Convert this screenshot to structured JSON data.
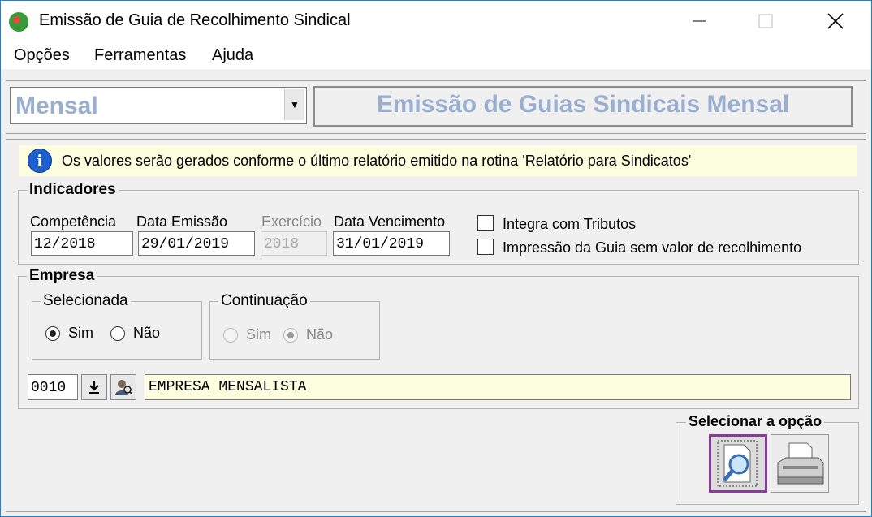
{
  "window": {
    "title": "Emissão de Guia de Recolhimento Sindical"
  },
  "menu": {
    "items": [
      "Opções",
      "Ferramentas",
      "Ajuda"
    ]
  },
  "period_select": {
    "value": "Mensal"
  },
  "header": {
    "title": "Emissão de Guias Sindicais Mensal"
  },
  "info": {
    "text": "Os valores serão gerados conforme o último relatório emitido na rotina 'Relatório para Sindicatos'"
  },
  "indicadores": {
    "title": "Indicadores",
    "competencia": {
      "label": "Competência",
      "value": "12/2018"
    },
    "data_emissao": {
      "label": "Data Emissão",
      "value": "29/01/2019"
    },
    "exercicio": {
      "label": "Exercício",
      "value": "2018"
    },
    "data_vencimento": {
      "label": "Data Vencimento",
      "value": "31/01/2019"
    },
    "integra_tributos": {
      "label": "Integra com Tributos",
      "checked": false
    },
    "impressao_sem_valor": {
      "label": "Impressão da Guia sem valor de recolhimento",
      "checked": false
    }
  },
  "empresa": {
    "title": "Empresa",
    "selecionada": {
      "title": "Selecionada",
      "sim": "Sim",
      "nao": "Não",
      "selected": "Sim"
    },
    "continuacao": {
      "title": "Continuação",
      "sim": "Sim",
      "nao": "Não",
      "selected": "Não"
    },
    "code": "0010",
    "name": "EMPRESA MENSALISTA"
  },
  "options": {
    "title": "Selecionar a opção"
  }
}
